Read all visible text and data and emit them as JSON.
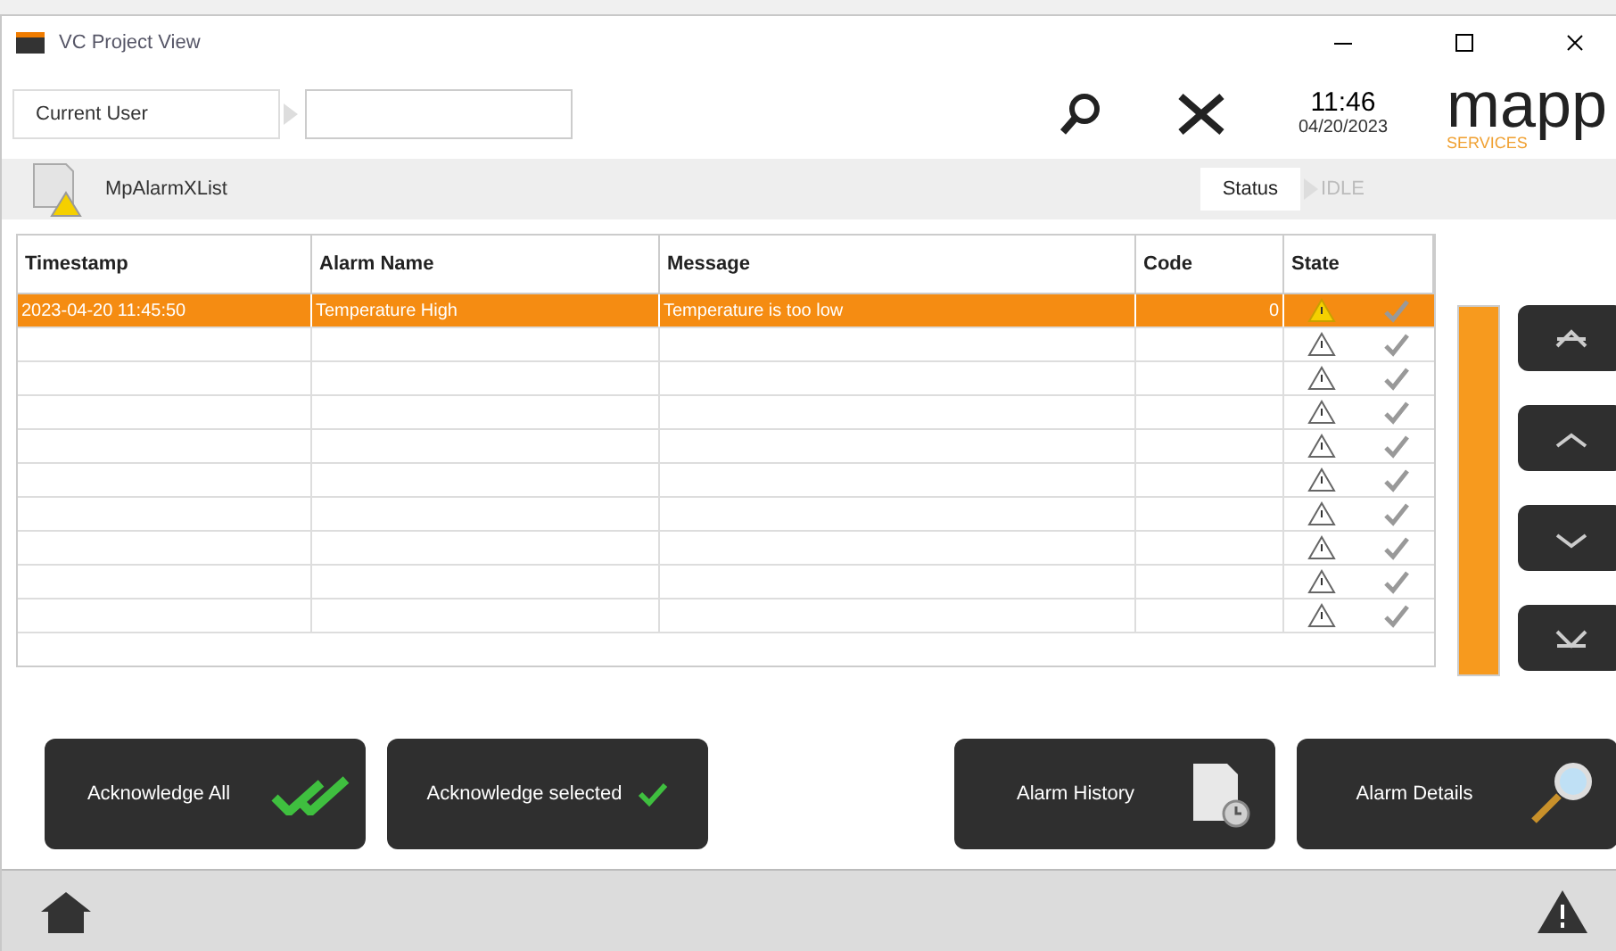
{
  "window": {
    "title": "VC Project View"
  },
  "toolbar": {
    "user_label": "Current User",
    "time": "11:46",
    "date": "04/20/2023",
    "logo": "mapp",
    "logo_sub": "SERVICES"
  },
  "list_bar": {
    "name": "MpAlarmXList",
    "status_label": "Status",
    "status_value": "IDLE"
  },
  "table": {
    "columns": [
      "Timestamp",
      "Alarm Name",
      "Message",
      "Code",
      "State"
    ],
    "rows": [
      {
        "timestamp": "2023-04-20 11:45:50",
        "name": "Temperature High",
        "message": "Temperature is too low",
        "code": "0",
        "selected": true,
        "active": true
      },
      {
        "selected": false,
        "active": false
      },
      {
        "selected": false,
        "active": false
      },
      {
        "selected": false,
        "active": false
      },
      {
        "selected": false,
        "active": false
      },
      {
        "selected": false,
        "active": false
      },
      {
        "selected": false,
        "active": false
      },
      {
        "selected": false,
        "active": false
      },
      {
        "selected": false,
        "active": false
      },
      {
        "selected": false,
        "active": false
      }
    ]
  },
  "buttons": [
    {
      "label": "Acknowledge All",
      "kind": "ack-all"
    },
    {
      "label": "Acknowledge selected",
      "kind": "ack-one"
    },
    {
      "label": "Alarm History",
      "kind": "history"
    },
    {
      "label": "Alarm Details",
      "kind": "details"
    }
  ]
}
